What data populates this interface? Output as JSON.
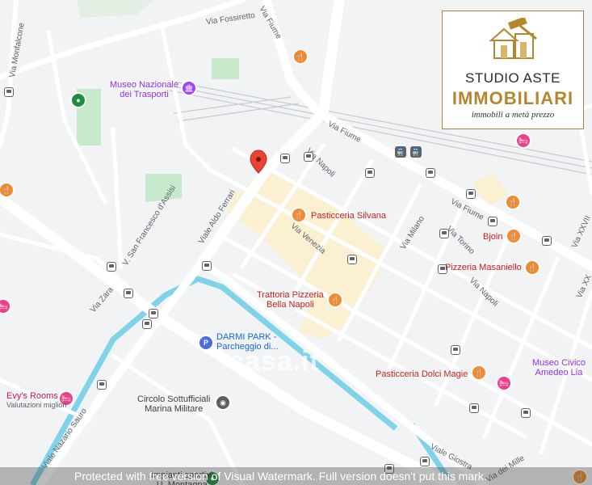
{
  "map": {
    "streets": {
      "via_monfalcone": "Via Monfalcone",
      "via_fossiretto": "Via Fossiretto",
      "via_fiume_top": "Via Fiume",
      "via_fiume_mid": "Via Fiume",
      "via_fiume_right": "Via Fiume",
      "via_napoli_top": "Via Napoli",
      "via_napoli_right": "Via Napoli",
      "viale_aldo_ferrari": "Viale Aldo Ferrari",
      "v_san_francesco": "V. San Francesco d'Assisi",
      "via_venezia": "Via Venezia",
      "via_milano": "Via Milano",
      "via_torino": "Via Torino",
      "via_zara": "Via Zara",
      "viale_nazario_sauro": "Viale Nazario Sauro",
      "via_xxviii": "Via XXVII",
      "via_xx": "Via XX",
      "viale_giostra": "Viale Giostra",
      "via_mille": "Via dei Mille"
    },
    "pois": {
      "museo_trasporti": "Museo Nazionale\ndei Trasporti",
      "pasticceria_silvana": "Pasticceria Silvana",
      "bjoin": "Bjoin",
      "pizzeria_masaniello": "Pizzeria Masaniello",
      "trattoria_bella_napoli": "Trattoria Pizzeria\nBella Napoli",
      "darmi_park": "DARMI PARK -\nParcheggio di...",
      "pasticceria_dolci_magie": "Pasticceria Dolci Magie",
      "museo_civico": "Museo Civico\nAmedeo Lia",
      "evys_rooms": "Evy's Rooms",
      "evys_rooms_sub": "Valutazioni migliori",
      "circolo_sottufficiali": "Circolo Sottufficiali\nMarina Militare",
      "impianti_sportivi": "Impianti sportivi\nU. Montagna"
    },
    "icons": {
      "food": "restaurant-icon",
      "hotel": "hotel-icon",
      "museum": "museum-icon",
      "park": "landmark-icon",
      "parking": "parking-icon",
      "pin": "location-pin-icon",
      "bus": "bus-stop-icon",
      "train": "train-icon"
    },
    "colors": {
      "road": "#ffffff",
      "background": "#f1f3f4",
      "water": "#7fd3e8",
      "green": "#bfe6c7",
      "highlight": "#fbf0d2",
      "pin": "#ea4335"
    }
  },
  "logo": {
    "line1": "STUDIO ASTE",
    "line2": "IMMOBILIARI",
    "line3": "immobili a metà prezzo"
  },
  "watermark": {
    "footer": "Protected with free version of Visual Watermark. Full version doesn't put this mark.",
    "center": "casa.it"
  }
}
